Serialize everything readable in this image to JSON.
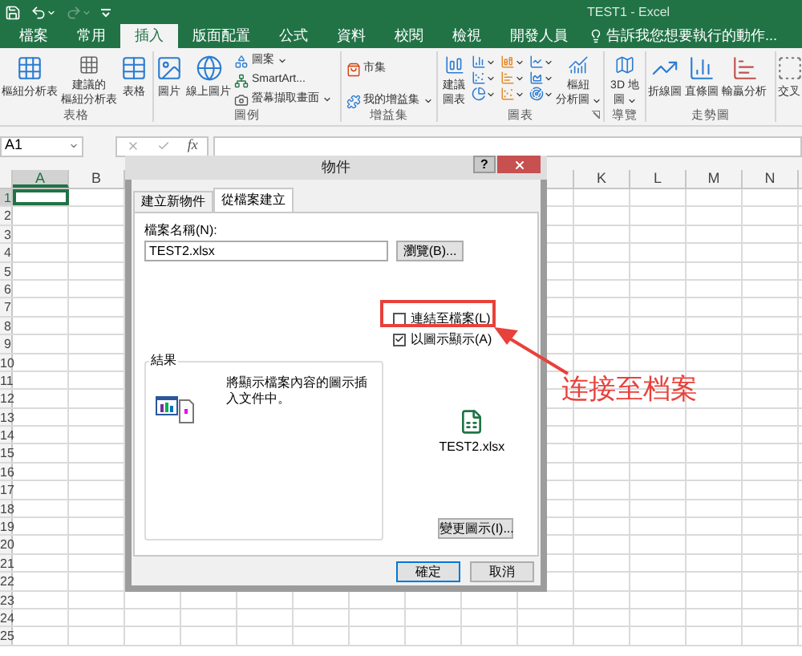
{
  "window": {
    "title": "TEST1 - Excel"
  },
  "quick_access": [
    {
      "kind": "save",
      "disabled": false
    },
    {
      "kind": "undo",
      "disabled": false
    },
    {
      "kind": "redo",
      "disabled": true
    },
    {
      "kind": "customize",
      "disabled": false
    }
  ],
  "ribbon_tabs": [
    {
      "label": "檔案",
      "selected": false
    },
    {
      "label": "常用",
      "selected": false
    },
    {
      "label": "插入",
      "selected": true
    },
    {
      "label": "版面配置",
      "selected": false
    },
    {
      "label": "公式",
      "selected": false
    },
    {
      "label": "資料",
      "selected": false
    },
    {
      "label": "校閱",
      "selected": false
    },
    {
      "label": "檢視",
      "selected": false
    },
    {
      "label": "開發人員",
      "selected": false
    }
  ],
  "tell_me": "告訴我您想要執行的動作...",
  "ribbon_groups": [
    {
      "label": "表格",
      "buttons": [
        {
          "kind": "large",
          "lines": [
            "樞紐分析表"
          ]
        },
        {
          "kind": "large",
          "lines": [
            "建議的",
            "樞紐分析表"
          ]
        },
        {
          "kind": "large",
          "lines": [
            "表格"
          ]
        }
      ]
    },
    {
      "label": "圖例",
      "buttons": [
        {
          "kind": "large",
          "lines": [
            "圖片"
          ]
        },
        {
          "kind": "large",
          "lines": [
            "線上圖片"
          ]
        },
        {
          "kind": "small",
          "lines": [
            "圖案"
          ],
          "dropdown": true
        },
        {
          "kind": "small",
          "lines": [
            "SmartArt..."
          ]
        },
        {
          "kind": "small",
          "lines": [
            "螢幕擷取畫面"
          ],
          "dropdown": true
        }
      ]
    },
    {
      "label": "增益集",
      "buttons": [
        {
          "kind": "small",
          "lines": [
            "市集"
          ]
        },
        {
          "kind": "small",
          "lines": [
            "我的增益集"
          ],
          "dropdown": true
        }
      ]
    },
    {
      "label": "圖表",
      "launcher": true,
      "buttons": [
        {
          "kind": "large",
          "lines": [
            "建議",
            "圖表"
          ]
        },
        {
          "kind": "chart_grid"
        },
        {
          "kind": "large",
          "lines": [
            "樞紐",
            "分析圖"
          ],
          "dropdown": true
        }
      ]
    },
    {
      "label": "導覽",
      "buttons": [
        {
          "kind": "large",
          "lines": [
            "3D 地",
            "圖"
          ],
          "dropdown": true
        }
      ]
    },
    {
      "label": "走勢圖",
      "buttons": [
        {
          "kind": "large",
          "lines": [
            "折線圖"
          ]
        },
        {
          "kind": "large",
          "lines": [
            "直條圖"
          ]
        },
        {
          "kind": "large",
          "lines": [
            "輸贏分析"
          ]
        }
      ]
    },
    {
      "buttons": [
        {
          "kind": "large",
          "lines": [
            "交叉"
          ]
        }
      ]
    }
  ],
  "name_box": "A1",
  "function_label": "fx",
  "columns": [
    {
      "label": "A",
      "selected": true
    },
    {
      "label": "B",
      "selected": false
    },
    {
      "label": "K",
      "selected": false
    },
    {
      "label": "L",
      "selected": false
    },
    {
      "label": "M",
      "selected": false
    },
    {
      "label": "N",
      "selected": false
    }
  ],
  "rows": [
    {
      "label": "1",
      "selected": true
    },
    {
      "label": "2",
      "selected": false
    },
    {
      "label": "3",
      "selected": false
    },
    {
      "label": "4",
      "selected": false
    },
    {
      "label": "5",
      "selected": false
    },
    {
      "label": "6",
      "selected": false
    },
    {
      "label": "7",
      "selected": false
    },
    {
      "label": "8",
      "selected": false
    },
    {
      "label": "9",
      "selected": false
    },
    {
      "label": "10",
      "selected": false
    },
    {
      "label": "11",
      "selected": false
    },
    {
      "label": "12",
      "selected": false
    },
    {
      "label": "13",
      "selected": false
    },
    {
      "label": "14",
      "selected": false
    },
    {
      "label": "15",
      "selected": false
    },
    {
      "label": "16",
      "selected": false
    },
    {
      "label": "17",
      "selected": false
    },
    {
      "label": "18",
      "selected": false
    },
    {
      "label": "19",
      "selected": false
    },
    {
      "label": "20",
      "selected": false
    },
    {
      "label": "21",
      "selected": false
    },
    {
      "label": "22",
      "selected": false
    },
    {
      "label": "23",
      "selected": false
    },
    {
      "label": "24",
      "selected": false
    },
    {
      "label": "25",
      "selected": false
    }
  ],
  "dialog": {
    "title": "物件",
    "help": "?",
    "tabs": [
      {
        "label": "建立新物件",
        "selected": false
      },
      {
        "label": "從檔案建立",
        "selected": true
      }
    ],
    "file_name_label": "檔案名稱(N):",
    "file_name": "TEST2.xlsx",
    "browse": "瀏覽(B)...",
    "options": [
      {
        "label": "連結至檔案(L)",
        "checked": false
      },
      {
        "label": "以圖示顯示(A)",
        "checked": true
      }
    ],
    "result_label": "結果",
    "result_text": "將顯示檔案內容的圖示插入文件中。",
    "icon_caption": "TEST2.xlsx",
    "change_icon": "變更圖示(I)...",
    "buttons": [
      {
        "label": "確定",
        "default": true
      },
      {
        "label": "取消",
        "default": false
      }
    ]
  },
  "annotation": {
    "label": "连接至档案"
  }
}
